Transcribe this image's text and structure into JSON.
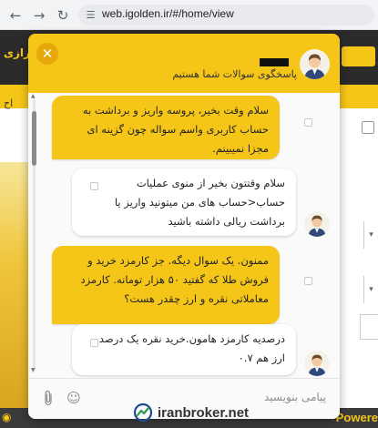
{
  "browser": {
    "url": "web.igolden.ir/#/home/view",
    "back_icon": "arrow-left",
    "forward_icon": "arrow-right",
    "reload_icon": "reload"
  },
  "page": {
    "header_left_text": "رازی",
    "side_text": "اح",
    "powered_text": "Powere"
  },
  "chat": {
    "header": {
      "subtitle": "پاسخگوی سوالات شما هستیم",
      "close_icon": "close-x"
    },
    "messages": [
      {
        "from": "user",
        "text": "سلام وقت بخیر، پروسه واریز و برداشت به حساب کاربری واسم سواله چون گزینه ای مجزا نمیبینم."
      },
      {
        "from": "agent",
        "text": "سلام وقتتون بخیر از منوی عملیات حساب<حساب های من میتونید واریز یا برداشت ریالی داشته باشید"
      },
      {
        "from": "user",
        "text": "ممنون. یک سوال دیگه. جز کارمزد خرید و فروش طلا که گفتید ۵۰ هزار تومانه. کارمزد معاملاتی نقره و ارز چقدر هست؟"
      },
      {
        "from": "agent",
        "text": "درصدیه کارمزد هامون.خرید نقره یک درصد و ارز هم ۰.۷"
      }
    ],
    "input_placeholder": "پیامی بنویسید",
    "emoji_icon": "smiley",
    "attach_icon": "paperclip"
  },
  "watermark": {
    "text": "iranbroker.net"
  },
  "colors": {
    "accent": "#f5c518",
    "header_dark": "#2b2b2b"
  }
}
